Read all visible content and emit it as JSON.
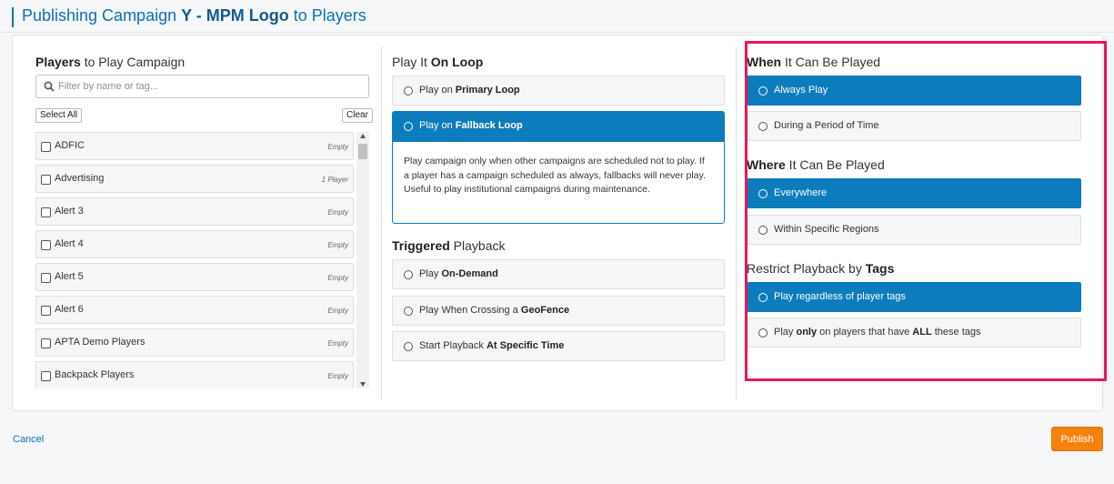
{
  "header": {
    "title_prefix": "Publishing Campaign ",
    "campaign_name": "Y - MPM Logo",
    "title_suffix": " to Players"
  },
  "players": {
    "title_bold": "Players",
    "title_rest": " to Play Campaign",
    "filter_placeholder": "Filter by name or tag...",
    "select_all_label": "Select All",
    "clear_label": "Clear",
    "items": [
      {
        "name": "ADFIC",
        "count": "Empty"
      },
      {
        "name": "Advertising",
        "count": "1 Player"
      },
      {
        "name": "Alert 3",
        "count": "Empty"
      },
      {
        "name": "Alert 4",
        "count": "Empty"
      },
      {
        "name": "Alert 5",
        "count": "Empty"
      },
      {
        "name": "Alert 6",
        "count": "Empty"
      },
      {
        "name": "APTA Demo Players",
        "count": "Empty"
      },
      {
        "name": "Backpack Players",
        "count": "Empty"
      }
    ]
  },
  "loop": {
    "title_rest": "Play It ",
    "title_bold": "On Loop",
    "primary_prefix": "Play on ",
    "primary_bold": "Primary Loop",
    "fallback_prefix": "Play on ",
    "fallback_bold": "Fallback Loop",
    "fallback_description": "Play campaign only when other campaigns are scheduled not to play. If a player has a campaign scheduled as always, fallbacks will never play. Useful to play institutional campaigns during maintenance."
  },
  "triggered": {
    "title_bold": "Triggered",
    "title_rest": " Playback",
    "ondemand_prefix": "Play ",
    "ondemand_bold": "On-Demand",
    "geofence_prefix": "Play When Crossing a ",
    "geofence_bold": "GeoFence",
    "time_prefix": "Start Playback ",
    "time_bold": "At Specific Time"
  },
  "when": {
    "title_bold": "When",
    "title_rest": " It Can Be Played",
    "always_label": "Always Play",
    "period_label": "During a Period of Time"
  },
  "where": {
    "title_bold": "Where",
    "title_rest": " It Can Be Played",
    "everywhere_label": "Everywhere",
    "regions_label": "Within Specific Regions"
  },
  "tags": {
    "title_rest": "Restrict Playback by ",
    "title_bold": "Tags",
    "regardless_label": "Play regardless of player tags",
    "only_prefix": "Play ",
    "only_bold": "only",
    "only_mid": " on players that have ",
    "only_bold2": "ALL",
    "only_suffix": " these tags"
  },
  "footer": {
    "cancel_label": "Cancel",
    "publish_label": "Publish"
  },
  "colors": {
    "accent": "#0c7cbd",
    "publish": "#f5820d",
    "highlight": "#e8175d"
  }
}
